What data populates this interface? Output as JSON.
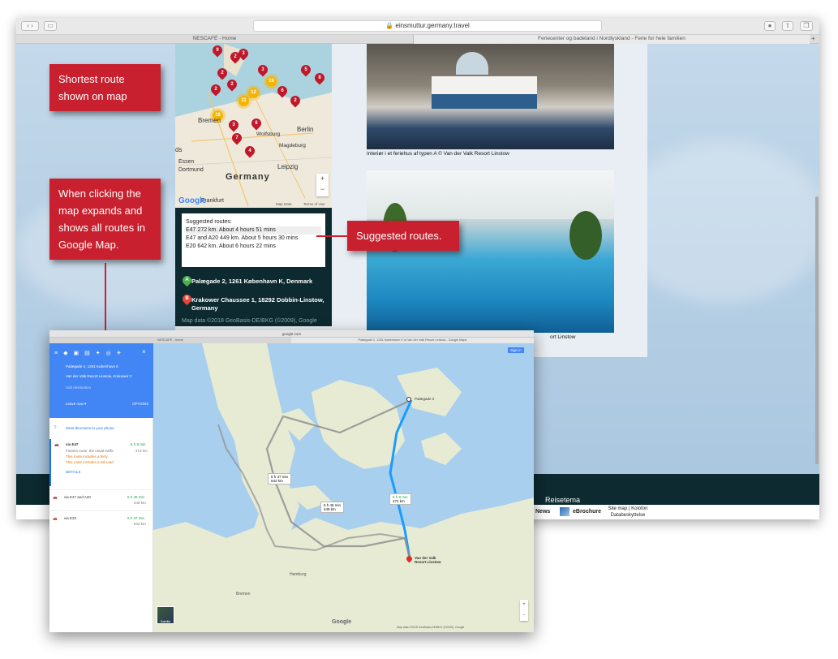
{
  "main_browser": {
    "url": "einsmuttur.germany.travel",
    "tabs": [
      "NESCAFÉ - Home",
      "Feriecenter og badeland i Nordtyskland - Ferie for hele familien"
    ]
  },
  "map": {
    "labels": {
      "country": "Germany",
      "berlin": "Berlin",
      "wolfsburg": "Wolfsburg",
      "magdeburg": "Magdeburg",
      "leipzig": "Leipzig",
      "essen": "Essen",
      "dortmund": "Dortmund",
      "frankfurt": "Frankfurt",
      "dus": "ds",
      "berlin_west": "Bremen",
      "google": "Google",
      "map_data": "Map Data",
      "terms": "Terms of Use"
    },
    "pins": [
      "9",
      "2",
      "3",
      "5",
      "2",
      "2",
      "3",
      "6",
      "2",
      "7",
      "4",
      "3",
      "6",
      "2",
      "8"
    ],
    "clusters": [
      "12",
      "10",
      "11",
      "18"
    ],
    "zoom_in": "+",
    "zoom_out": "−"
  },
  "routes": {
    "heading": "Suggested routes:",
    "items": [
      {
        "name": "E47",
        "detail": "272 km. About 4 hours 51 mins"
      },
      {
        "name": "E47 and A20",
        "detail": "449 km. About 5 hours 30 mins"
      },
      {
        "name": "E20",
        "detail": "642 km. About 6 hours 22 mins"
      }
    ],
    "origin_marker": "A",
    "origin": "Palægade 2, 1261 København K, Denmark",
    "dest_marker": "B",
    "destination": "Krakower Chaussee 1, 18292 Dobbin-Linstow, Germany",
    "map_data": "Map data ©2018 GeoBasis-DE/BKG (©2009), Google"
  },
  "captions": {
    "photo1": "Interiør i et feriehus af typen A © Van der Valk Resort Linstow",
    "photo2": "ort Linstow"
  },
  "footer": {
    "reisetema": "Reisetema",
    "news": "News",
    "ebrochure": "eBrochure",
    "sitemap": "Site map | Kolofon",
    "privacy": "Databeskyttelse"
  },
  "callouts": {
    "shortest": "Shortest route shown on map",
    "clicking": "When clicking the map expands and shows all routes in Google Map.",
    "suggested": "Suggested routes."
  },
  "google_maps": {
    "url": "google.com",
    "tab_left": "NESCAFÉ - Home",
    "tab_right": "Palægade 2, 1261 København K to Van der Valk Resort Linstow - Google Maps",
    "from": "Palægade 2, 1261 København K",
    "to": "Van der Valk Resort Linstow, Krakower C",
    "add_dest": "Add destination",
    "leave_now": "Leave now ▾",
    "options": "OPTIONS",
    "send": "Send directions to your phone",
    "close": "×",
    "sign_in": "Sign in",
    "routes": [
      {
        "name": "via E47",
        "time": "5 h 8 min",
        "dist": "272 km",
        "note": "Fastest route, the usual traffic",
        "warn1": "This route includes a ferry",
        "warn2": "This route includes a toll road",
        "details": "DETAILS"
      },
      {
        "name": "via E47 and A20",
        "time": "5 h 45 min",
        "dist": "449 km"
      },
      {
        "name": "via E20",
        "time": "6 h 37 min",
        "dist": "642 km"
      }
    ],
    "bubbles": [
      {
        "time": "5 h 8 min",
        "dist": "272 km"
      },
      {
        "time": "5 h 45 min",
        "dist": "449 km"
      },
      {
        "time": "6 h 37 min",
        "dist": "642 km"
      }
    ],
    "places": {
      "copenhagen": "Palægade 2",
      "hamburg": "Hamburg",
      "bremen": "Bremen",
      "dest": "Van der Valk Resort Linstow"
    },
    "satellite": "Satellite",
    "google": "Google",
    "mapdata": "Map data ©2018 GeoBasis-DE/BKG (©2009), Google"
  },
  "colors": {
    "callout": "#c8202e",
    "route_blue": "#1a9cff",
    "route_gray": "#8f8f8f",
    "dark_teal": "#0c2a30"
  }
}
